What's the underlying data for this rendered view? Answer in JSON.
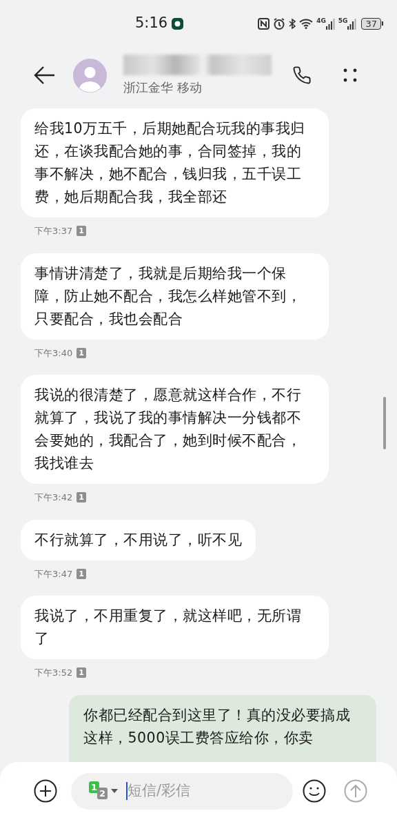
{
  "status_bar": {
    "time": "5:16",
    "network_4g": "4G",
    "network_5g": "5G",
    "battery": "37"
  },
  "header": {
    "subtitle": "浙江金华 移动"
  },
  "messages": [
    {
      "kind": "received",
      "text": "给我10万五千，后期她配合玩我的事我归还，在谈我配合她的事，合同签掉，我的事不解决，她不配合，钱归我，五千误工费，她后期配合我，我全部还",
      "time": "下午3:37",
      "sim": "1"
    },
    {
      "kind": "received",
      "text": "事情讲清楚了，我就是后期给我一个保障，防止她不配合，我怎么样她管不到，只要配合，我也会配合",
      "time": "下午3:40",
      "sim": "1"
    },
    {
      "kind": "received",
      "text": "我说的很清楚了，愿意就这样合作，不行就算了，我说了我的事情解决一分钱都不会要她的，我配合了，她到时候不配合，我找谁去",
      "time": "下午3:42",
      "sim": "1"
    },
    {
      "kind": "received",
      "text": "不行就算了，不用说了，听不见",
      "time": "下午3:47",
      "sim": "1"
    },
    {
      "kind": "received",
      "text": "我说了，不用重复了，就这样吧，无所谓了",
      "time": "下午3:52",
      "sim": "1"
    },
    {
      "kind": "sent",
      "text": "你都已经配合到这里了！真的没必要搞成这样，5000误工费答应给你，你卖"
    }
  ],
  "composer": {
    "sim_primary": "1",
    "sim_secondary": "2",
    "placeholder": "短信/彩信"
  }
}
